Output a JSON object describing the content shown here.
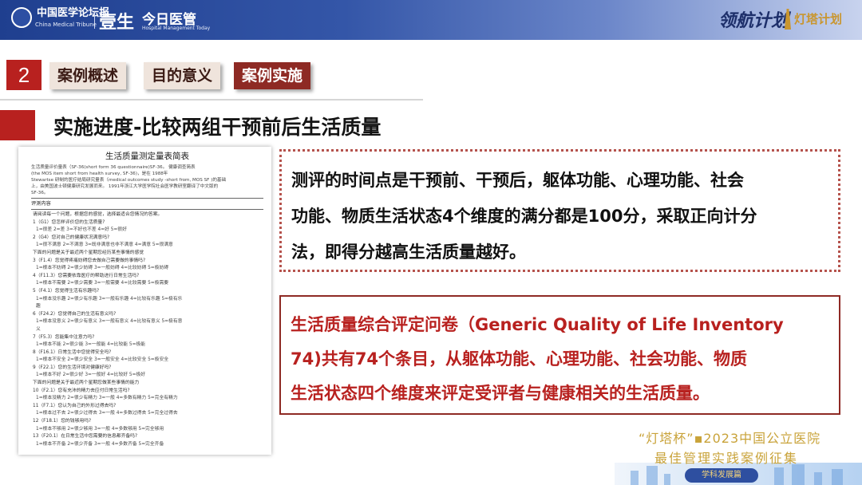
{
  "header": {
    "brand_cn": "中国医学论坛报",
    "brand_en": "China Medical Tribune",
    "brand_yisheng": "壹生",
    "brand_hm_cn": "今日医管",
    "brand_hm_en": "Hospital Management Today",
    "right_logo_1": "领航计划",
    "right_logo_2": "灯塔计划"
  },
  "nav": {
    "number": "2",
    "tabs": [
      {
        "label": "案例概述"
      },
      {
        "label": "目的意义"
      },
      {
        "label": "案例实施"
      }
    ]
  },
  "section_title": "实施进度-比较两组干预前后生活质量",
  "questionnaire": {
    "title": "生活质量测定量表简表",
    "intro": [
      "生活质量评价量表（SF-36(short form 36 questionnaire)SF-36。 健康调查简表",
      "(the MOS item short from health survey, SF-36)，是在 1988年",
      "Stewartse 研制的医疗结局研究量表（medical outcomes study -short from, MOS SF )的基础",
      "上，由美国波士顿健康研究发展而来。 1991年浙江大学医学院社会医学教研室翻译了中文版的",
      "SF-36。"
    ],
    "section_label": "评测内容",
    "lines": [
      {
        "t": "请阅读每一个问题，根据您的感觉，选择最适合您情况的答案。",
        "k": "q"
      },
      {
        "t": "1（G1）您怎样评价您的生活质量?",
        "k": "q"
      },
      {
        "t": "1=很差   2=差   3=不好也不差   4=好   5=很好",
        "k": "opt"
      },
      {
        "t": "2（G4）您对自己的健康状况满意吗?",
        "k": "q"
      },
      {
        "t": "1=很不满意   2=不满意   3=既非满意也非不满意   4=满意   5=很满意",
        "k": "opt"
      },
      {
        "t": "下面的问题是关于最近两个星期您经历某些事情的感觉",
        "k": "q"
      },
      {
        "t": "3（F1.4）您觉得疼痛妨碍您去做自己需要做的事情吗?",
        "k": "q"
      },
      {
        "t": "1=根本不妨碍   2=很少妨碍   3=一般妨碍   4=比较妨碍   5=极妨碍",
        "k": "opt"
      },
      {
        "t": "4（F11.3）您需要依靠医疗的帮助进行日常生活吗?",
        "k": "q"
      },
      {
        "t": "1=根本不需要   2=很少需要   3=一般需要   4=比较需要   5=极需要",
        "k": "opt"
      },
      {
        "t": "5（F4.1）您觉得生活有乐趣吗?",
        "k": "q"
      },
      {
        "t": "1=根本没乐趣   2=很少有乐趣   3=一般有乐趣   4=比较有乐趣   5=极有乐",
        "k": "opt"
      },
      {
        "t": "趣",
        "k": "opt"
      },
      {
        "t": "6（F24.2）您觉得自己的生活有意义吗?",
        "k": "q"
      },
      {
        "t": "1=根本没意义   2=很少有意义   3=一般有意义   4=比较有意义   5=极有意",
        "k": "opt"
      },
      {
        "t": "义",
        "k": "opt"
      },
      {
        "t": "7（F5.3）您能集中注意力吗?",
        "k": "q"
      },
      {
        "t": "1=根本不能   2=很少能   3=一般能   4=比较能   5=极能",
        "k": "opt"
      },
      {
        "t": "8（F16.1）日常生活中您觉得安全吗?",
        "k": "q"
      },
      {
        "t": "1=根本不安全   2=很少安全   3=一般安全   4=比较安全   5=极安全",
        "k": "opt"
      },
      {
        "t": "9（F22.1）您的生活环境对健康好吗?",
        "k": "q"
      },
      {
        "t": "1=根本不好   2=很少好   3=一般好   4=比较好   5=极好",
        "k": "opt"
      },
      {
        "t": "下面的问题是关于最近两个星期您做某些事情的能力",
        "k": "q"
      },
      {
        "t": "10（F2.1）您有充沛的精力去应付日常生活吗?",
        "k": "q"
      },
      {
        "t": "1=根本没精力   2=很少有精力   3=一般   4=多数有精力   5=完全有精力",
        "k": "opt"
      },
      {
        "t": "11（F7.1）您认为自己的外形过得去吗?",
        "k": "q"
      },
      {
        "t": "1=根本过不去   2=很少过得去   3=一般   4=多数过得去   5=完全过得去",
        "k": "opt"
      },
      {
        "t": "12（F18.1）您的钱够用吗?",
        "k": "q"
      },
      {
        "t": "1=根本不够用   2=很少够用   3=一般   4=多数够用   5=完全够用",
        "k": "opt"
      },
      {
        "t": "13（F20.1）在日常生活中您需要的信息都齐备吗?",
        "k": "q"
      },
      {
        "t": "1=根本不齐备   2=很少齐备   3=一般   4=多数齐备   5=完全齐备",
        "k": "opt"
      }
    ]
  },
  "info_box": {
    "lines": [
      "测评的时间点是干预前、干预后，躯体功能、心理功能、社会",
      "功能、物质生活状态4个维度的满分都是100分，采取正向计分",
      "法，即得分越高生活质量越好。"
    ]
  },
  "inventory_box": {
    "lines": [
      "生活质量综合评定问卷（Generic Quality of Life Inventory",
      "74)共有74个条目，从躯体功能、心理功能、社会功能、物质",
      "生活状态四个维度来评定受评者与健康相关的生活质量。"
    ]
  },
  "footer": {
    "cup_label": "“灯塔杯”▪2023中国公立医院",
    "cup_sub": "最佳管理实践案例征集",
    "pill": "学科发展篇"
  }
}
